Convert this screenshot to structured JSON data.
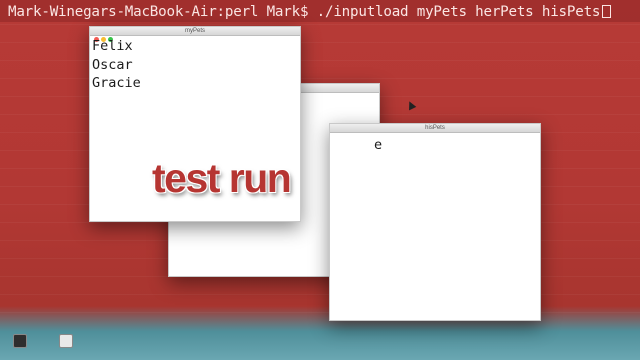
{
  "terminal": {
    "prompt": "Mark-Winegars-MacBook-Air:perl Mark$ ./inputload myPets herPets hisPets"
  },
  "windows": {
    "myPets": {
      "title": "myPets",
      "lines": [
        "Felix",
        "Oscar",
        "Gracie"
      ]
    },
    "herPets": {
      "title": "",
      "lines": []
    },
    "hisPets": {
      "title": "hisPets",
      "visible_text": "e"
    }
  },
  "overlay": {
    "title": "test run"
  },
  "colors": {
    "desktop_red": "#b73a36",
    "overlay_text": "#b63532",
    "dock_teal": "#5b9aa5"
  },
  "icons": {
    "window_close": "close-button-icon",
    "window_minimize": "minimize-button-icon",
    "window_zoom": "zoom-button-icon",
    "cursor": "mouse-pointer-icon"
  },
  "dock": {
    "items": [
      {
        "icon": "terminal-icon"
      },
      {
        "icon": "editor-icon"
      }
    ]
  }
}
